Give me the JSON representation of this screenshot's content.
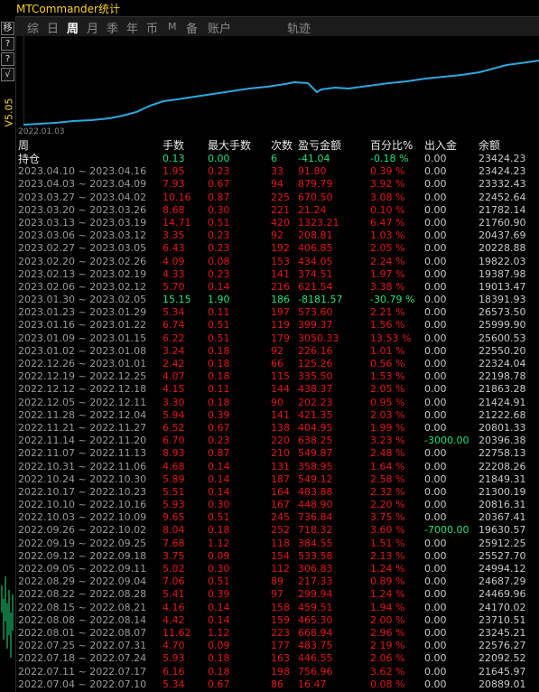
{
  "window": {
    "title": "MTCommander统计"
  },
  "tabs": [
    {
      "label": "综",
      "active": false,
      "small": false
    },
    {
      "label": "日",
      "active": false,
      "small": false
    },
    {
      "label": "周",
      "active": true,
      "small": false
    },
    {
      "label": "月",
      "active": false,
      "small": false
    },
    {
      "label": "季",
      "active": false,
      "small": false
    },
    {
      "label": "年",
      "active": false,
      "small": false
    },
    {
      "label": "币",
      "active": false,
      "small": false
    },
    {
      "label": "M",
      "active": false,
      "small": true
    },
    {
      "label": "备",
      "active": false,
      "small": false
    },
    {
      "label": "账户",
      "active": false,
      "small": false
    },
    {
      "label": "轨迹",
      "active": false,
      "small": false
    }
  ],
  "left_toolbar": {
    "btn1": "移",
    "btn2": "?",
    "btn3": "?",
    "btn4": "√",
    "version": "V5.05"
  },
  "colors": {
    "accent_yellow": "#ffd21f",
    "loss_red": "#e4161b",
    "gain_green": "#1ee37b",
    "curve_blue": "#2aa9e0"
  },
  "chart": {
    "start_date": "2022.01.03"
  },
  "headers": {
    "week": "周",
    "lots": "手数",
    "max_lots": "最大手数",
    "count": "次数",
    "pl": "盈亏金额",
    "pct": "百分比%",
    "io": "出入金",
    "balance": "余额"
  },
  "holding": {
    "label": "持仓",
    "lots": "0.13",
    "max": "0.00",
    "count": "6",
    "pl": "-41.04",
    "pct": "-0.18 %",
    "io": "0.00",
    "bal": "23424.23"
  },
  "rows": [
    {
      "week": "2023.04.10 ~ 2023.04.16",
      "lots": "1.95",
      "max": "0.23",
      "cnt": "33",
      "pl": "91.80",
      "pct": "0.39 %",
      "io": "0.00",
      "bal": "23424.23"
    },
    {
      "week": "2023.04.03 ~ 2023.04.09",
      "lots": "7.93",
      "max": "0.67",
      "cnt": "94",
      "pl": "879.79",
      "pct": "3.92 %",
      "io": "0.00",
      "bal": "23332.43"
    },
    {
      "week": "2023.03.27 ~ 2023.04.02",
      "lots": "10.16",
      "max": "0.87",
      "cnt": "225",
      "pl": "670.50",
      "pct": "3.08 %",
      "io": "0.00",
      "bal": "22452.64"
    },
    {
      "week": "2023.03.20 ~ 2023.03.26",
      "lots": "8.68",
      "max": "0.30",
      "cnt": "221",
      "pl": "21.24",
      "pct": "0.10 %",
      "io": "0.00",
      "bal": "21782.14"
    },
    {
      "week": "2023.03.13 ~ 2023.03.19",
      "lots": "14.71",
      "max": "0.51",
      "cnt": "420",
      "pl": "1323.21",
      "pct": "6.47 %",
      "io": "0.00",
      "bal": "21760.90"
    },
    {
      "week": "2023.03.06 ~ 2023.03.12",
      "lots": "3.35",
      "max": "0.23",
      "cnt": "92",
      "pl": "208.81",
      "pct": "1.03 %",
      "io": "0.00",
      "bal": "20437.69"
    },
    {
      "week": "2023.02.27 ~ 2023.03.05",
      "lots": "6.43",
      "max": "0.23",
      "cnt": "192",
      "pl": "406.85",
      "pct": "2.05 %",
      "io": "0.00",
      "bal": "20228.88"
    },
    {
      "week": "2023.02.20 ~ 2023.02.26",
      "lots": "4.09",
      "max": "0.08",
      "cnt": "153",
      "pl": "434.05",
      "pct": "2.24 %",
      "io": "0.00",
      "bal": "19822.03"
    },
    {
      "week": "2023.02.13 ~ 2023.02.19",
      "lots": "4.33",
      "max": "0.23",
      "cnt": "141",
      "pl": "374.51",
      "pct": "1.97 %",
      "io": "0.00",
      "bal": "19387.98"
    },
    {
      "week": "2023.02.06 ~ 2023.02.12",
      "lots": "5.70",
      "max": "0.14",
      "cnt": "216",
      "pl": "621.54",
      "pct": "3.38 %",
      "io": "0.00",
      "bal": "19013.47"
    },
    {
      "week": "2023.01.30 ~ 2023.02.05",
      "lots": "15.15",
      "max": "1.90",
      "cnt": "186",
      "pl": "-8181.57",
      "pct": "-30.79 %",
      "io": "0.00",
      "bal": "18391.93",
      "neg": true
    },
    {
      "week": "2023.01.23 ~ 2023.01.29",
      "lots": "5.34",
      "max": "0.11",
      "cnt": "197",
      "pl": "573.60",
      "pct": "2.21 %",
      "io": "0.00",
      "bal": "26573.50"
    },
    {
      "week": "2023.01.16 ~ 2023.01.22",
      "lots": "6.74",
      "max": "0.51",
      "cnt": "119",
      "pl": "399.37",
      "pct": "1.56 %",
      "io": "0.00",
      "bal": "25999.90"
    },
    {
      "week": "2023.01.09 ~ 2023.01.15",
      "lots": "6.22",
      "max": "0.51",
      "cnt": "179",
      "pl": "3050.33",
      "pct": "13.53 %",
      "io": "0.00",
      "bal": "25600.53"
    },
    {
      "week": "2023.01.02 ~ 2023.01.08",
      "lots": "3.24",
      "max": "0.18",
      "cnt": "92",
      "pl": "226.16",
      "pct": "1.01 %",
      "io": "0.00",
      "bal": "22550.20"
    },
    {
      "week": "2022.12.26 ~ 2023.01.01",
      "lots": "2.42",
      "max": "0.18",
      "cnt": "66",
      "pl": "125.26",
      "pct": "0.56 %",
      "io": "0.00",
      "bal": "22324.04"
    },
    {
      "week": "2022.12.19 ~ 2022.12.25",
      "lots": "4.07",
      "max": "0.18",
      "cnt": "115",
      "pl": "335.50",
      "pct": "1.53 %",
      "io": "0.00",
      "bal": "22198.78"
    },
    {
      "week": "2022.12.12 ~ 2022.12.18",
      "lots": "4.15",
      "max": "0.11",
      "cnt": "144",
      "pl": "438.37",
      "pct": "2.05 %",
      "io": "0.00",
      "bal": "21863.28"
    },
    {
      "week": "2022.12.05 ~ 2022.12.11",
      "lots": "3.30",
      "max": "0.18",
      "cnt": "90",
      "pl": "202.23",
      "pct": "0.95 %",
      "io": "0.00",
      "bal": "21424.91"
    },
    {
      "week": "2022.11.28 ~ 2022.12.04",
      "lots": "5.94",
      "max": "0.39",
      "cnt": "141",
      "pl": "421.35",
      "pct": "2.03 %",
      "io": "0.00",
      "bal": "21222.68"
    },
    {
      "week": "2022.11.21 ~ 2022.11.27",
      "lots": "6.52",
      "max": "0.67",
      "cnt": "138",
      "pl": "404.95",
      "pct": "1.99 %",
      "io": "0.00",
      "bal": "20801.33"
    },
    {
      "week": "2022.11.14 ~ 2022.11.20",
      "lots": "6.70",
      "max": "0.23",
      "cnt": "220",
      "pl": "638.25",
      "pct": "3.23 %",
      "io": "-3000.00",
      "bal": "20396.38",
      "io_green": true
    },
    {
      "week": "2022.11.07 ~ 2022.11.13",
      "lots": "8.93",
      "max": "0.87",
      "cnt": "210",
      "pl": "549.87",
      "pct": "2.48 %",
      "io": "0.00",
      "bal": "22758.13"
    },
    {
      "week": "2022.10.31 ~ 2022.11.06",
      "lots": "4.68",
      "max": "0.14",
      "cnt": "131",
      "pl": "358.95",
      "pct": "1.64 %",
      "io": "0.00",
      "bal": "22208.26"
    },
    {
      "week": "2022.10.24 ~ 2022.10.30",
      "lots": "5.89",
      "max": "0.14",
      "cnt": "187",
      "pl": "549.12",
      "pct": "2.58 %",
      "io": "0.00",
      "bal": "21849.31"
    },
    {
      "week": "2022.10.17 ~ 2022.10.23",
      "lots": "5.51",
      "max": "0.14",
      "cnt": "164",
      "pl": "483.88",
      "pct": "2.32 %",
      "io": "0.00",
      "bal": "21300.19"
    },
    {
      "week": "2022.10.10 ~ 2022.10.16",
      "lots": "5.93",
      "max": "0.30",
      "cnt": "167",
      "pl": "448.90",
      "pct": "2.20 %",
      "io": "0.00",
      "bal": "20816.31"
    },
    {
      "week": "2022.10.03 ~ 2022.10.09",
      "lots": "9.65",
      "max": "0.51",
      "cnt": "245",
      "pl": "736.84",
      "pct": "3.75 %",
      "io": "0.00",
      "bal": "20367.41"
    },
    {
      "week": "2022.09.26 ~ 2022.10.02",
      "lots": "8.04",
      "max": "0.18",
      "cnt": "252",
      "pl": "718.32",
      "pct": "3.60 %",
      "io": "-7000.00",
      "bal": "19630.57",
      "io_green": true
    },
    {
      "week": "2022.09.19 ~ 2022.09.25",
      "lots": "7.68",
      "max": "1.12",
      "cnt": "118",
      "pl": "384.55",
      "pct": "1.51 %",
      "io": "0.00",
      "bal": "25912.25"
    },
    {
      "week": "2022.09.12 ~ 2022.09.18",
      "lots": "3.75",
      "max": "0.09",
      "cnt": "154",
      "pl": "533.58",
      "pct": "2.13 %",
      "io": "0.00",
      "bal": "25527.70"
    },
    {
      "week": "2022.09.05 ~ 2022.09.11",
      "lots": "5.02",
      "max": "0.30",
      "cnt": "112",
      "pl": "306.83",
      "pct": "1.24 %",
      "io": "0.00",
      "bal": "24994.12"
    },
    {
      "week": "2022.08.29 ~ 2022.09.04",
      "lots": "7.06",
      "max": "0.51",
      "cnt": "89",
      "pl": "217.33",
      "pct": "0.89 %",
      "io": "0.00",
      "bal": "24687.29"
    },
    {
      "week": "2022.08.22 ~ 2022.08.28",
      "lots": "5.41",
      "max": "0.39",
      "cnt": "97",
      "pl": "299.94",
      "pct": "1.24 %",
      "io": "0.00",
      "bal": "24469.96"
    },
    {
      "week": "2022.08.15 ~ 2022.08.21",
      "lots": "4.16",
      "max": "0.14",
      "cnt": "158",
      "pl": "459.51",
      "pct": "1.94 %",
      "io": "0.00",
      "bal": "24170.02"
    },
    {
      "week": "2022.08.08 ~ 2022.08.14",
      "lots": "4.42",
      "max": "0.14",
      "cnt": "159",
      "pl": "465.30",
      "pct": "2.00 %",
      "io": "0.00",
      "bal": "23710.51"
    },
    {
      "week": "2022.08.01 ~ 2022.08.07",
      "lots": "11.62",
      "max": "1.12",
      "cnt": "223",
      "pl": "668.94",
      "pct": "2.96 %",
      "io": "0.00",
      "bal": "23245.21"
    },
    {
      "week": "2022.07.25 ~ 2022.07.31",
      "lots": "4.70",
      "max": "0.09",
      "cnt": "177",
      "pl": "483.75",
      "pct": "2.19 %",
      "io": "0.00",
      "bal": "22576.27"
    },
    {
      "week": "2022.07.18 ~ 2022.07.24",
      "lots": "5.93",
      "max": "0.18",
      "cnt": "163",
      "pl": "446.55",
      "pct": "2.06 %",
      "io": "0.00",
      "bal": "22092.52"
    },
    {
      "week": "2022.07.11 ~ 2022.07.17",
      "lots": "6.16",
      "max": "0.18",
      "cnt": "198",
      "pl": "756.96",
      "pct": "3.62 %",
      "io": "0.00",
      "bal": "21645.97"
    },
    {
      "week": "2022.07.04 ~ 2022.07.10",
      "lots": "5.34",
      "max": "0.67",
      "cnt": "86",
      "pl": "16.47",
      "pct": "0.08 %",
      "io": "0.00",
      "bal": "20889.01"
    }
  ]
}
